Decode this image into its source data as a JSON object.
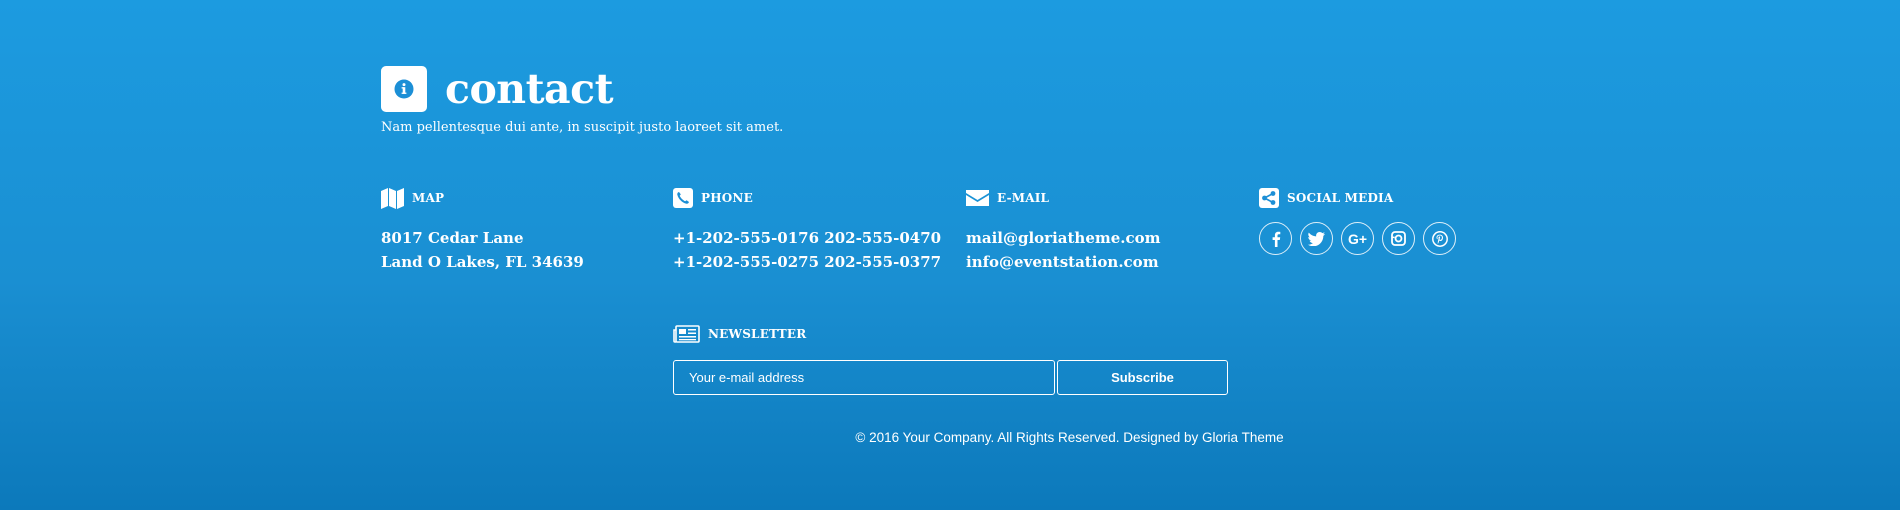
{
  "header": {
    "icon": "info-icon",
    "title": "contact",
    "subtitle": "Nam pellentesque dui ante, in suscipit justo laoreet sit amet."
  },
  "columns": {
    "map": {
      "icon": "map-icon",
      "label": "MAP",
      "lines": [
        "8017 Cedar Lane",
        "Land O Lakes, FL 34639"
      ]
    },
    "phone": {
      "icon": "phone-icon",
      "label": "PHONE",
      "lines": [
        "+1-202-555-0176 202-555-0470",
        "+1-202-555-0275 202-555-0377"
      ]
    },
    "email": {
      "icon": "envelope-icon",
      "label": "E-MAIL",
      "lines": [
        "mail@gloriatheme.com",
        "info@eventstation.com"
      ]
    },
    "social": {
      "icon": "share-icon",
      "label": "SOCIAL MEDIA",
      "links": [
        "facebook-icon",
        "twitter-icon",
        "google-plus-icon",
        "instagram-icon",
        "pinterest-icon"
      ]
    }
  },
  "newsletter": {
    "icon": "newspaper-icon",
    "label": "NEWSLETTER",
    "placeholder": "Your e-mail address",
    "value": "",
    "button": "Subscribe"
  },
  "footer": {
    "copyright": "© 2016 Your Company. All Rights Reserved. Designed by Gloria Theme"
  },
  "colors": {
    "background_top": "#1c9be0",
    "background_bottom": "#0c79bb",
    "accent": "#1c8fd6",
    "text": "#ffffff"
  }
}
